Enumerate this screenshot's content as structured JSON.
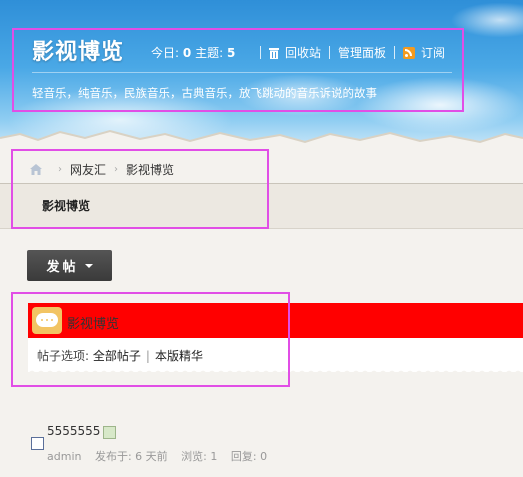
{
  "header": {
    "site_title": "影视博览",
    "stats_today_label": "今日:",
    "stats_today_value": "0",
    "stats_topics_label": "主题:",
    "stats_topics_value": "5",
    "toolbar": [
      "回收站",
      "管理面板",
      "订阅"
    ],
    "description": "轻音乐，纯音乐，民族音乐，古典音乐，放飞跳动的音乐诉说的故事"
  },
  "breadcrumb": [
    "网友汇",
    "影视博览"
  ],
  "forum_name": "影视博览",
  "post_button": "发帖",
  "forum_bar": {
    "title": "影视博览",
    "icon": "chat-bubble-icon",
    "color": "#ff0000"
  },
  "options": {
    "label": "帖子选项:",
    "all": "全部帖子",
    "featured": "本版精华"
  },
  "thread": {
    "title": "5555555",
    "author": "admin",
    "posted": "发布于: 6 天前",
    "views": "浏览: 1",
    "replies": "回复: 0"
  },
  "colors": {
    "highlight": "#e14ee6",
    "accent": "#ff0000"
  }
}
